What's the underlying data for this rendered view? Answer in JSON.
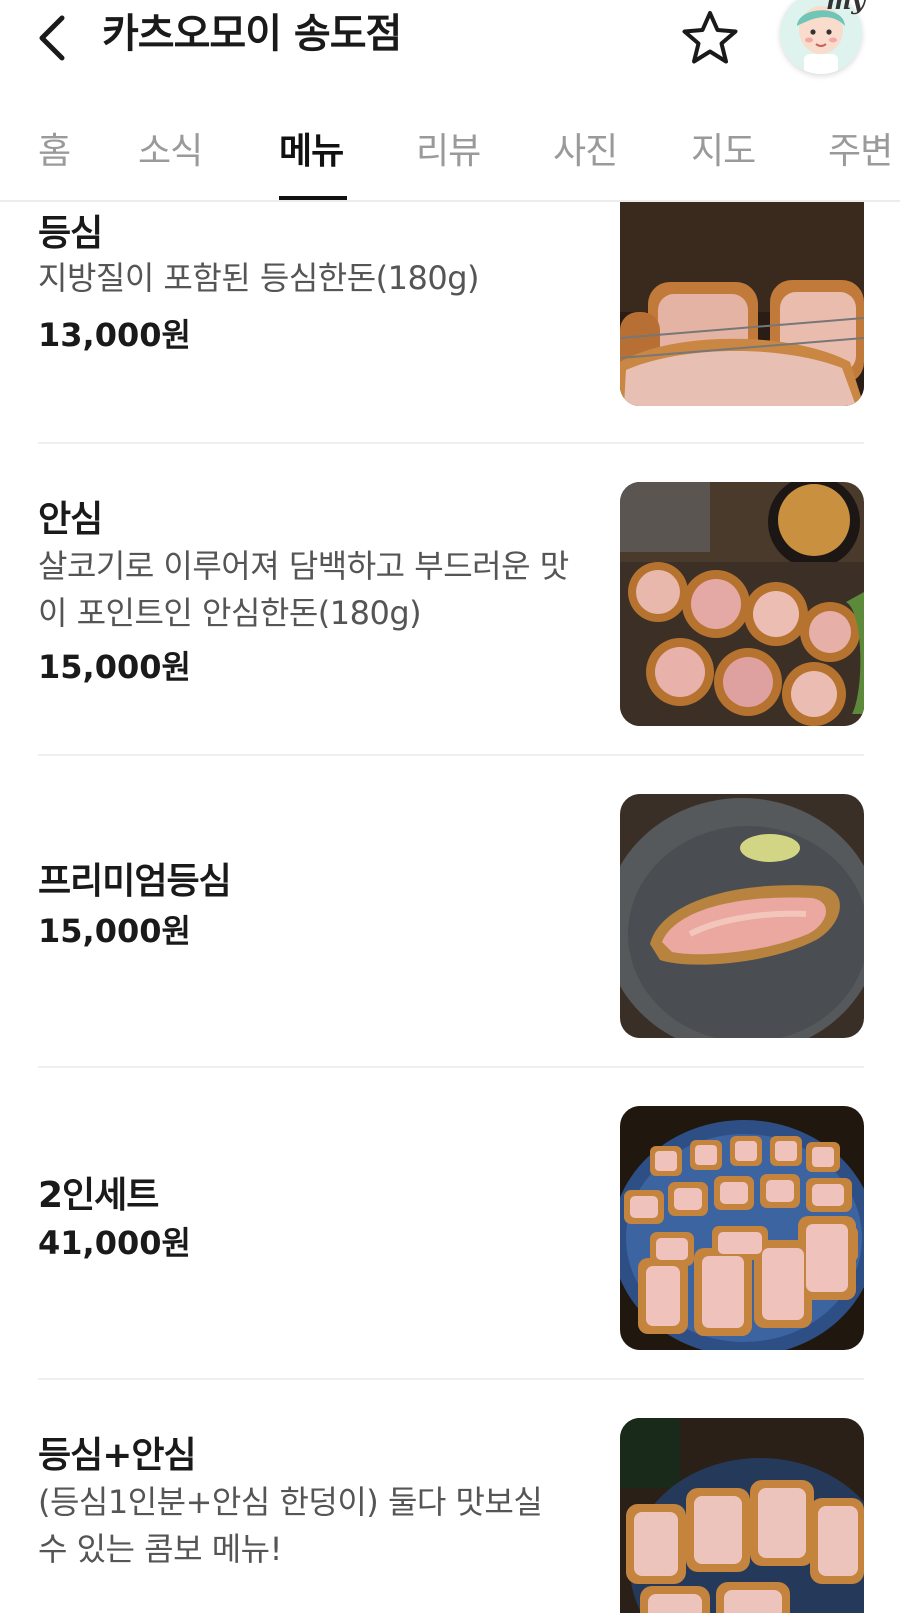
{
  "header": {
    "title": "카츠오모이 송도점",
    "back_icon": "chevron-left-icon",
    "favorite_icon": "star-outline-icon",
    "avatar_tag": "my"
  },
  "tabs": [
    {
      "label": "홈",
      "active": false
    },
    {
      "label": "소식",
      "active": false
    },
    {
      "label": "메뉴",
      "active": true
    },
    {
      "label": "리뷰",
      "active": false
    },
    {
      "label": "사진",
      "active": false
    },
    {
      "label": "지도",
      "active": false
    },
    {
      "label": "주변",
      "active": false
    }
  ],
  "menu": [
    {
      "name": "등심",
      "desc": "지방질이 포함된 등심한돈(180g)",
      "price": "13,000원",
      "photo": "pork-loin-cutlet-photo"
    },
    {
      "name": "안심",
      "desc": "살코기로 이루어져 담백하고 부드러운 맛이 포인트인 안심한돈(180g)",
      "price": "15,000원",
      "photo": "pork-tenderloin-cutlet-photo"
    },
    {
      "name": "프리미엄등심",
      "desc": "",
      "price": "15,000원",
      "photo": "premium-loin-cutlet-photo"
    },
    {
      "name": "2인세트",
      "desc": "",
      "price": "41,000원",
      "photo": "two-person-set-photo"
    },
    {
      "name": "등심+안심",
      "desc": "(등심1인분+안심 한덩이) 둘다 맛보실 수 있는 콤보 메뉴!",
      "price": "",
      "photo": "loin-tenderloin-combo-photo"
    }
  ],
  "colors": {
    "active_tab": "#111111",
    "inactive_tab": "#9a9a9a",
    "divider": "#efefef"
  }
}
